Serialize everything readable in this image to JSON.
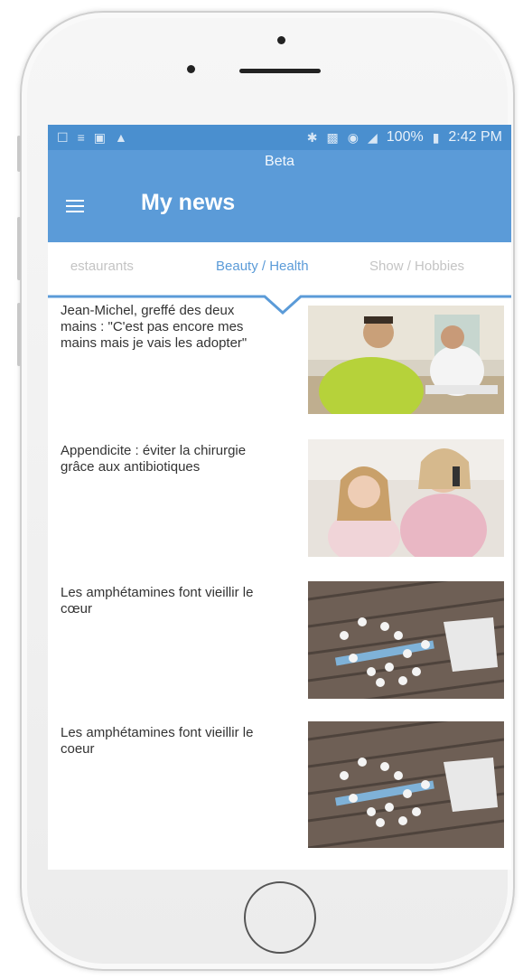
{
  "status_bar": {
    "left_icons": [
      "notification-icon",
      "voicemail-icon",
      "image-icon",
      "warning-icon"
    ],
    "right_icons": [
      "bluetooth-icon",
      "nfc-icon",
      "wifi-icon",
      "signal-icon",
      "battery-icon"
    ],
    "battery": "100%",
    "time": "2:42 PM"
  },
  "app_bar": {
    "subtitle": "Beta",
    "title": "My news",
    "menu_icon": "hamburger-menu-icon"
  },
  "tabs": [
    {
      "label": "Restaurants",
      "active": false
    },
    {
      "label": "Beauty / Health",
      "active": true
    },
    {
      "label": "Show / Hobbies",
      "active": false
    }
  ],
  "articles": [
    {
      "title": "Jean-Michel, greffé des deux mains : \"C'est pas encore mes mains mais je vais les adopter\"",
      "image": "doctor-consultation-photo"
    },
    {
      "title": "Appendicite : éviter la chirurgie grâce aux antibiotiques",
      "image": "mother-daughter-phone-photo"
    },
    {
      "title": "Les amphétamines font vieillir le cœur",
      "image": "pills-syringe-photo"
    },
    {
      "title": "Les amphétamines font vieillir le coeur",
      "image": "pills-syringe-photo"
    }
  ],
  "colors": {
    "accent": "#5b9bd8",
    "status_bar": "#4a8fcf"
  }
}
